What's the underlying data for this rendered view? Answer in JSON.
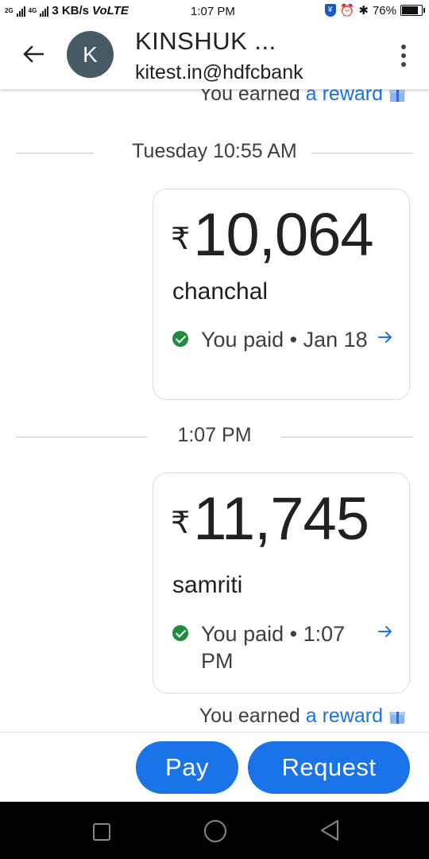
{
  "status_bar": {
    "net_tag_top": "2G",
    "net_tag_mid": "4G",
    "speed": "3 KB/s",
    "volte": "VoLTE",
    "time": "1:07 PM",
    "battery": "76%",
    "battery_level": 0.76
  },
  "header": {
    "avatar_letter": "K",
    "name": "KINSHUK ...",
    "upi_id": "kitest.in@hdfcbank"
  },
  "chat": {
    "reward_top": {
      "prefix": "You earned ",
      "link": "a reward"
    },
    "messages": [
      {
        "separator": "Tuesday 10:55 AM",
        "currency": "₹",
        "amount": "10,064",
        "payee": "chanchal",
        "status": "You paid • Jan 18"
      },
      {
        "separator": "1:07 PM",
        "currency": "₹",
        "amount": "11,745",
        "payee": "samriti",
        "status": "You paid • 1:07 PM"
      }
    ],
    "reward_bottom": {
      "prefix": "You earned ",
      "link": "a reward"
    }
  },
  "actions": {
    "pay_label": "Pay",
    "request_label": "Request"
  },
  "colors": {
    "accent": "#1a73e8",
    "success": "#1e8e3e",
    "avatar_bg": "#455a64"
  }
}
